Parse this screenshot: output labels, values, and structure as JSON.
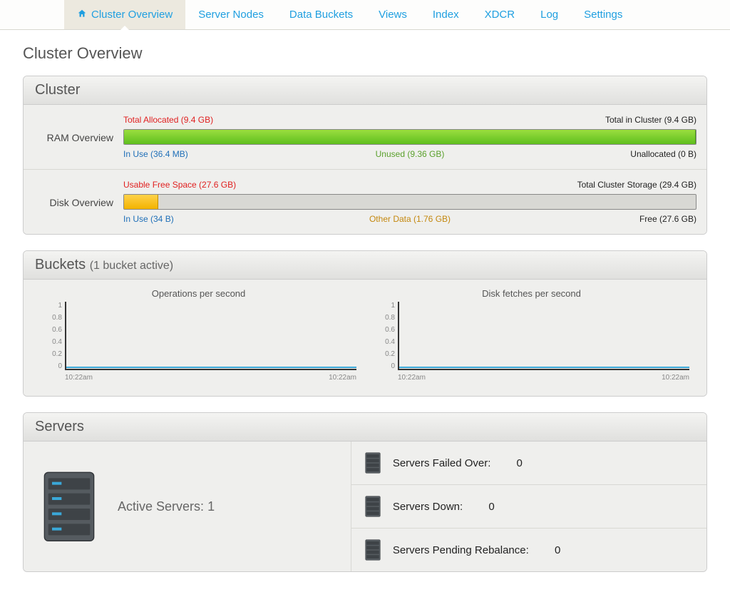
{
  "nav": {
    "tabs": [
      "Cluster Overview",
      "Server Nodes",
      "Data Buckets",
      "Views",
      "Index",
      "XDCR",
      "Log",
      "Settings"
    ]
  },
  "page_title": "Cluster Overview",
  "cluster_panel": {
    "title": "Cluster",
    "ram": {
      "label": "RAM Overview",
      "top_left": "Total Allocated (9.4 GB)",
      "top_right": "Total in Cluster (9.4 GB)",
      "bar_green_pct": 100,
      "bottom_left": "In Use (36.4 MB)",
      "bottom_mid": "Unused (9.36 GB)",
      "bottom_right": "Unallocated (0 B)"
    },
    "disk": {
      "label": "Disk Overview",
      "top_left": "Usable Free Space (27.6 GB)",
      "top_right": "Total Cluster Storage (29.4 GB)",
      "bar_yellow_pct": 6,
      "bottom_left": "In Use (34 B)",
      "bottom_mid": "Other Data (1.76 GB)",
      "bottom_right": "Free (27.6 GB)"
    }
  },
  "buckets_panel": {
    "title": "Buckets",
    "subtitle": "(1 bucket active)",
    "charts": [
      {
        "title": "Operations per second",
        "x_start": "10:22am",
        "x_end": "10:22am"
      },
      {
        "title": "Disk fetches per second",
        "x_start": "10:22am",
        "x_end": "10:22am"
      }
    ],
    "yticks": [
      "1",
      "0.8",
      "0.6",
      "0.4",
      "0.2",
      "0"
    ]
  },
  "servers_panel": {
    "title": "Servers",
    "active_label": "Active Servers:",
    "active_count": "1",
    "rows": [
      {
        "label": "Servers Failed Over:",
        "value": "0"
      },
      {
        "label": "Servers Down:",
        "value": "0"
      },
      {
        "label": "Servers Pending Rebalance:",
        "value": "0"
      }
    ]
  },
  "chart_data": [
    {
      "type": "line",
      "title": "Operations per second",
      "x": [
        "10:22am",
        "10:22am"
      ],
      "series": [
        {
          "name": "ops",
          "values": [
            0,
            0
          ]
        }
      ],
      "ylim": [
        0,
        1
      ],
      "yticks": [
        0,
        0.2,
        0.4,
        0.6,
        0.8,
        1
      ]
    },
    {
      "type": "line",
      "title": "Disk fetches per second",
      "x": [
        "10:22am",
        "10:22am"
      ],
      "series": [
        {
          "name": "fetches",
          "values": [
            0,
            0
          ]
        }
      ],
      "ylim": [
        0,
        1
      ],
      "yticks": [
        0,
        0.2,
        0.4,
        0.6,
        0.8,
        1
      ]
    }
  ]
}
